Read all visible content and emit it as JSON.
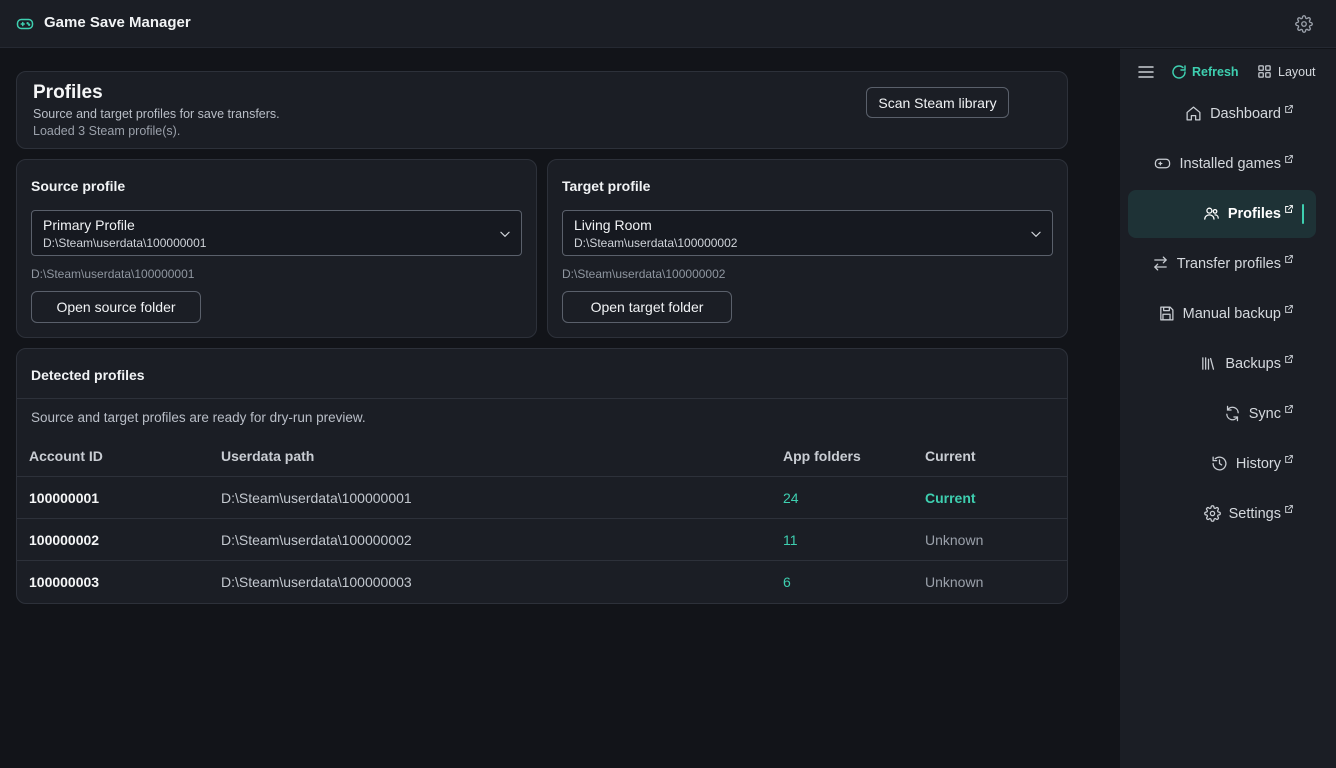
{
  "app": {
    "title": "Game Save Manager"
  },
  "header": {
    "title": "Profiles",
    "subtitle": "Source and target profiles for save transfers.",
    "status": "Loaded 3 Steam profile(s).",
    "scan_label": "Scan Steam library"
  },
  "source": {
    "title": "Source profile",
    "selected_name": "Primary Profile",
    "selected_path": "D:\\Steam\\userdata\\100000001",
    "path_note": "D:\\Steam\\userdata\\100000001",
    "open_label": "Open source folder"
  },
  "target": {
    "title": "Target profile",
    "selected_name": "Living Room",
    "selected_path": "D:\\Steam\\userdata\\100000002",
    "path_note": "D:\\Steam\\userdata\\100000002",
    "open_label": "Open target folder"
  },
  "detected": {
    "title": "Detected profiles",
    "description": "Source and target profiles are ready for dry-run preview.",
    "columns": [
      "Account ID",
      "Userdata path",
      "App folders",
      "Current"
    ],
    "rows": [
      {
        "account_id": "100000001",
        "path": "D:\\Steam\\userdata\\100000001",
        "app_folders": "24",
        "current": "Current"
      },
      {
        "account_id": "100000002",
        "path": "D:\\Steam\\userdata\\100000002",
        "app_folders": "11",
        "current": "Unknown"
      },
      {
        "account_id": "100000003",
        "path": "D:\\Steam\\userdata\\100000003",
        "app_folders": "6",
        "current": "Unknown"
      }
    ]
  },
  "sidebar": {
    "refresh_label": "Refresh",
    "layout_label": "Layout",
    "items": [
      {
        "label": "Dashboard",
        "icon": "home-icon"
      },
      {
        "label": "Installed games",
        "icon": "gamepad-icon"
      },
      {
        "label": "Profiles",
        "icon": "users-icon",
        "active": true
      },
      {
        "label": "Transfer profiles",
        "icon": "arrows-swap-icon"
      },
      {
        "label": "Manual backup",
        "icon": "save-icon"
      },
      {
        "label": "Backups",
        "icon": "library-icon"
      },
      {
        "label": "Sync",
        "icon": "sync-icon"
      },
      {
        "label": "History",
        "icon": "history-icon"
      },
      {
        "label": "Settings",
        "icon": "gear-icon"
      }
    ]
  },
  "colors": {
    "accent": "#3ecfb0",
    "background": "#121419",
    "panel": "#1b1e25",
    "active_nav": "#1e3236"
  }
}
